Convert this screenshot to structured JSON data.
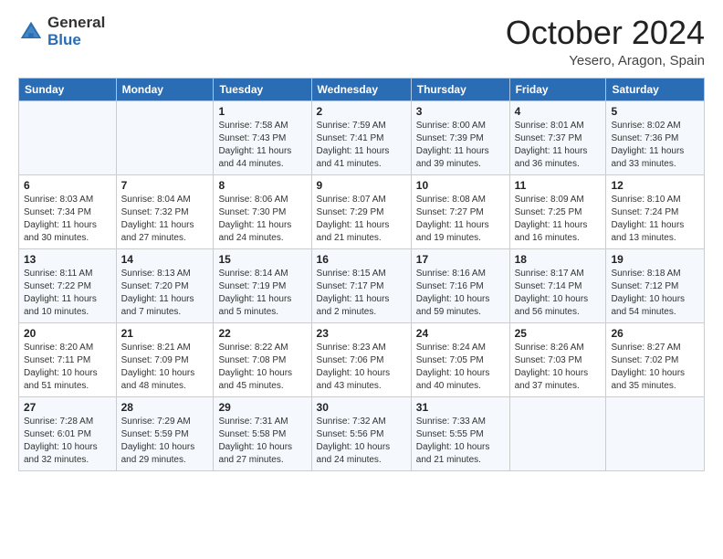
{
  "logo": {
    "general": "General",
    "blue": "Blue"
  },
  "header": {
    "month": "October 2024",
    "location": "Yesero, Aragon, Spain"
  },
  "weekdays": [
    "Sunday",
    "Monday",
    "Tuesday",
    "Wednesday",
    "Thursday",
    "Friday",
    "Saturday"
  ],
  "weeks": [
    [
      {
        "day": "",
        "info": ""
      },
      {
        "day": "",
        "info": ""
      },
      {
        "day": "1",
        "info": "Sunrise: 7:58 AM\nSunset: 7:43 PM\nDaylight: 11 hours\nand 44 minutes."
      },
      {
        "day": "2",
        "info": "Sunrise: 7:59 AM\nSunset: 7:41 PM\nDaylight: 11 hours\nand 41 minutes."
      },
      {
        "day": "3",
        "info": "Sunrise: 8:00 AM\nSunset: 7:39 PM\nDaylight: 11 hours\nand 39 minutes."
      },
      {
        "day": "4",
        "info": "Sunrise: 8:01 AM\nSunset: 7:37 PM\nDaylight: 11 hours\nand 36 minutes."
      },
      {
        "day": "5",
        "info": "Sunrise: 8:02 AM\nSunset: 7:36 PM\nDaylight: 11 hours\nand 33 minutes."
      }
    ],
    [
      {
        "day": "6",
        "info": "Sunrise: 8:03 AM\nSunset: 7:34 PM\nDaylight: 11 hours\nand 30 minutes."
      },
      {
        "day": "7",
        "info": "Sunrise: 8:04 AM\nSunset: 7:32 PM\nDaylight: 11 hours\nand 27 minutes."
      },
      {
        "day": "8",
        "info": "Sunrise: 8:06 AM\nSunset: 7:30 PM\nDaylight: 11 hours\nand 24 minutes."
      },
      {
        "day": "9",
        "info": "Sunrise: 8:07 AM\nSunset: 7:29 PM\nDaylight: 11 hours\nand 21 minutes."
      },
      {
        "day": "10",
        "info": "Sunrise: 8:08 AM\nSunset: 7:27 PM\nDaylight: 11 hours\nand 19 minutes."
      },
      {
        "day": "11",
        "info": "Sunrise: 8:09 AM\nSunset: 7:25 PM\nDaylight: 11 hours\nand 16 minutes."
      },
      {
        "day": "12",
        "info": "Sunrise: 8:10 AM\nSunset: 7:24 PM\nDaylight: 11 hours\nand 13 minutes."
      }
    ],
    [
      {
        "day": "13",
        "info": "Sunrise: 8:11 AM\nSunset: 7:22 PM\nDaylight: 11 hours\nand 10 minutes."
      },
      {
        "day": "14",
        "info": "Sunrise: 8:13 AM\nSunset: 7:20 PM\nDaylight: 11 hours\nand 7 minutes."
      },
      {
        "day": "15",
        "info": "Sunrise: 8:14 AM\nSunset: 7:19 PM\nDaylight: 11 hours\nand 5 minutes."
      },
      {
        "day": "16",
        "info": "Sunrise: 8:15 AM\nSunset: 7:17 PM\nDaylight: 11 hours\nand 2 minutes."
      },
      {
        "day": "17",
        "info": "Sunrise: 8:16 AM\nSunset: 7:16 PM\nDaylight: 10 hours\nand 59 minutes."
      },
      {
        "day": "18",
        "info": "Sunrise: 8:17 AM\nSunset: 7:14 PM\nDaylight: 10 hours\nand 56 minutes."
      },
      {
        "day": "19",
        "info": "Sunrise: 8:18 AM\nSunset: 7:12 PM\nDaylight: 10 hours\nand 54 minutes."
      }
    ],
    [
      {
        "day": "20",
        "info": "Sunrise: 8:20 AM\nSunset: 7:11 PM\nDaylight: 10 hours\nand 51 minutes."
      },
      {
        "day": "21",
        "info": "Sunrise: 8:21 AM\nSunset: 7:09 PM\nDaylight: 10 hours\nand 48 minutes."
      },
      {
        "day": "22",
        "info": "Sunrise: 8:22 AM\nSunset: 7:08 PM\nDaylight: 10 hours\nand 45 minutes."
      },
      {
        "day": "23",
        "info": "Sunrise: 8:23 AM\nSunset: 7:06 PM\nDaylight: 10 hours\nand 43 minutes."
      },
      {
        "day": "24",
        "info": "Sunrise: 8:24 AM\nSunset: 7:05 PM\nDaylight: 10 hours\nand 40 minutes."
      },
      {
        "day": "25",
        "info": "Sunrise: 8:26 AM\nSunset: 7:03 PM\nDaylight: 10 hours\nand 37 minutes."
      },
      {
        "day": "26",
        "info": "Sunrise: 8:27 AM\nSunset: 7:02 PM\nDaylight: 10 hours\nand 35 minutes."
      }
    ],
    [
      {
        "day": "27",
        "info": "Sunrise: 7:28 AM\nSunset: 6:01 PM\nDaylight: 10 hours\nand 32 minutes."
      },
      {
        "day": "28",
        "info": "Sunrise: 7:29 AM\nSunset: 5:59 PM\nDaylight: 10 hours\nand 29 minutes."
      },
      {
        "day": "29",
        "info": "Sunrise: 7:31 AM\nSunset: 5:58 PM\nDaylight: 10 hours\nand 27 minutes."
      },
      {
        "day": "30",
        "info": "Sunrise: 7:32 AM\nSunset: 5:56 PM\nDaylight: 10 hours\nand 24 minutes."
      },
      {
        "day": "31",
        "info": "Sunrise: 7:33 AM\nSunset: 5:55 PM\nDaylight: 10 hours\nand 21 minutes."
      },
      {
        "day": "",
        "info": ""
      },
      {
        "day": "",
        "info": ""
      }
    ]
  ]
}
